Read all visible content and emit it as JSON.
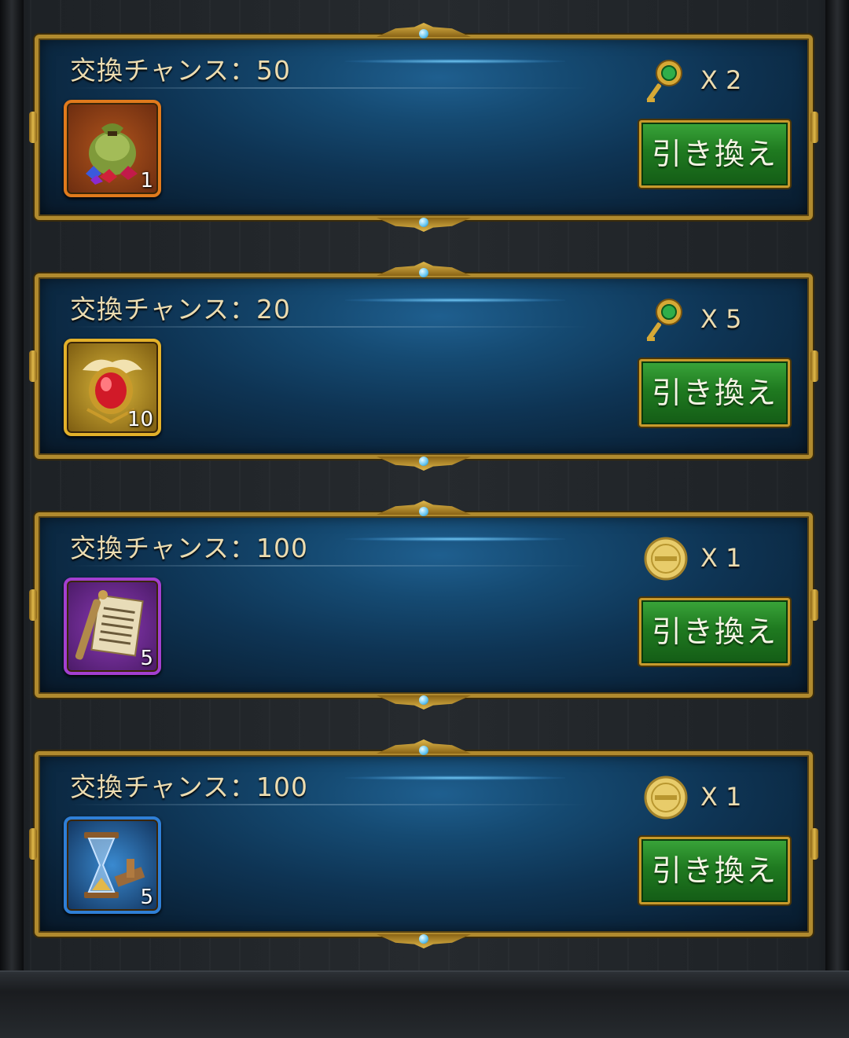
{
  "offers": [
    {
      "chance_label": "交換チャンス：50",
      "item": {
        "icon": "item-bag-of-gems-icon",
        "count": "1",
        "frame_color": "#e07a1c",
        "bg": "#6b2c10"
      },
      "cost": {
        "icon": "gold-key-icon",
        "qty": "X 2"
      },
      "button_label": "引き換え"
    },
    {
      "chance_label": "交換チャンス：20",
      "item": {
        "icon": "item-red-gem-medal-icon",
        "count": "10",
        "frame_color": "#e3b12a",
        "bg": "#7a5a10"
      },
      "cost": {
        "icon": "gold-key-icon",
        "qty": "X 5"
      },
      "button_label": "引き換え"
    },
    {
      "chance_label": "交換チャンス：100",
      "item": {
        "icon": "item-scroll-icon",
        "count": "5",
        "frame_color": "#a33fd0",
        "bg": "#4a1a66"
      },
      "cost": {
        "icon": "gold-coin-icon",
        "qty": "X 1"
      },
      "button_label": "引き換え"
    },
    {
      "chance_label": "交換チャンス：100",
      "item": {
        "icon": "item-hourglass-speedup-icon",
        "count": "5",
        "frame_color": "#2f7fd6",
        "bg": "#12345e"
      },
      "cost": {
        "icon": "gold-coin-icon",
        "qty": "X 1"
      },
      "button_label": "引き換え"
    }
  ]
}
